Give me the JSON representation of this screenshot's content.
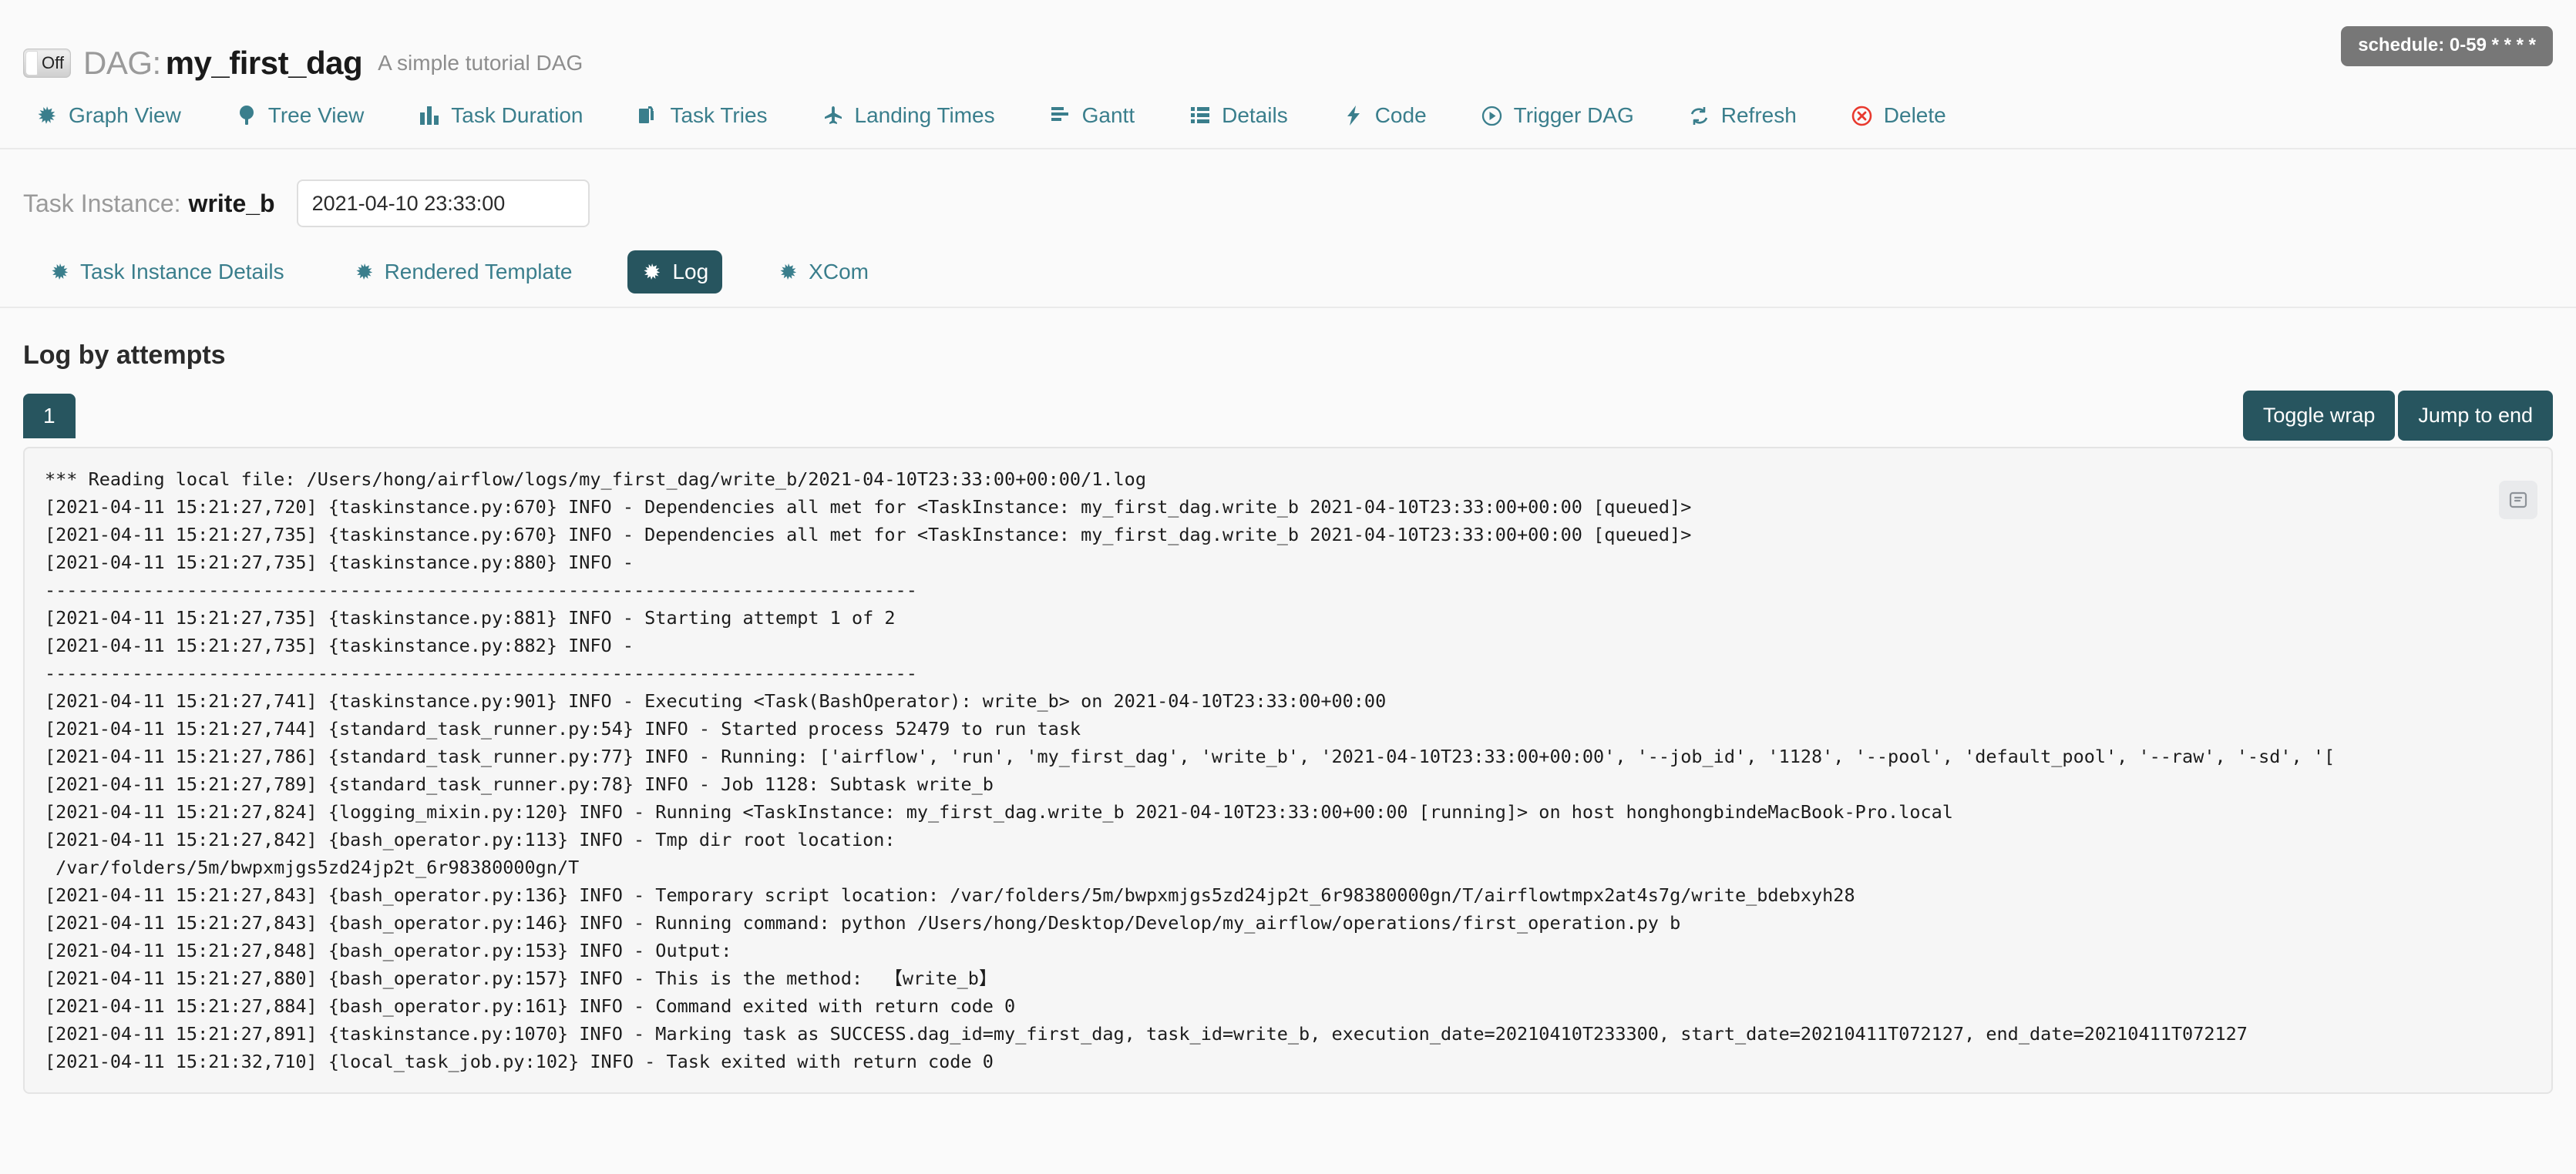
{
  "header": {
    "toggle_label": "Off",
    "dag_word": "DAG:",
    "dag_id": "my_first_dag",
    "description": "A simple tutorial DAG",
    "schedule_badge": "schedule: 0-59 * * * *"
  },
  "main_nav": [
    {
      "label": "Graph View",
      "icon": "asterisk-icon"
    },
    {
      "label": "Tree View",
      "icon": "tree-icon"
    },
    {
      "label": "Task Duration",
      "icon": "bar-chart-icon"
    },
    {
      "label": "Task Tries",
      "icon": "copy-files-icon"
    },
    {
      "label": "Landing Times",
      "icon": "plane-icon"
    },
    {
      "label": "Gantt",
      "icon": "align-left-icon"
    },
    {
      "label": "Details",
      "icon": "list-icon"
    },
    {
      "label": "Code",
      "icon": "bolt-icon"
    },
    {
      "label": "Trigger DAG",
      "icon": "play-circle-icon"
    },
    {
      "label": "Refresh",
      "icon": "refresh-icon"
    },
    {
      "label": "Delete",
      "icon": "delete-circle-icon"
    }
  ],
  "task_instance": {
    "label": "Task Instance:",
    "task_id": "write_b",
    "execution_date": "2021-04-10 23:33:00",
    "date_placeholder": "2021-04-10 23:33:00"
  },
  "sub_tabs": [
    {
      "label": "Task Instance Details",
      "icon": "asterisk-icon",
      "active": false
    },
    {
      "label": "Rendered Template",
      "icon": "asterisk-icon",
      "active": false
    },
    {
      "label": "Log",
      "icon": "asterisk-icon",
      "active": true
    },
    {
      "label": "XCom",
      "icon": "asterisk-icon",
      "active": false
    }
  ],
  "log_section": {
    "heading": "Log by attempts",
    "attempt_tabs": [
      "1"
    ],
    "toggle_wrap_label": "Toggle wrap",
    "jump_to_end_label": "Jump to end"
  },
  "colors": {
    "accent_teal": "#3a7e8c",
    "active_teal": "#27555f",
    "delete_red": "#e8392e",
    "badge_grey": "#777777",
    "log_bg": "#f6f6f6"
  },
  "log_lines": [
    "*** Reading local file: /Users/hong/airflow/logs/my_first_dag/write_b/2021-04-10T23:33:00+00:00/1.log",
    "[2021-04-11 15:21:27,720] {taskinstance.py:670} INFO - Dependencies all met for <TaskInstance: my_first_dag.write_b 2021-04-10T23:33:00+00:00 [queued]>",
    "[2021-04-11 15:21:27,735] {taskinstance.py:670} INFO - Dependencies all met for <TaskInstance: my_first_dag.write_b 2021-04-10T23:33:00+00:00 [queued]>",
    "[2021-04-11 15:21:27,735] {taskinstance.py:880} INFO - ",
    "--------------------------------------------------------------------------------",
    "[2021-04-11 15:21:27,735] {taskinstance.py:881} INFO - Starting attempt 1 of 2",
    "[2021-04-11 15:21:27,735] {taskinstance.py:882} INFO - ",
    "--------------------------------------------------------------------------------",
    "[2021-04-11 15:21:27,741] {taskinstance.py:901} INFO - Executing <Task(BashOperator): write_b> on 2021-04-10T23:33:00+00:00",
    "[2021-04-11 15:21:27,744] {standard_task_runner.py:54} INFO - Started process 52479 to run task",
    "[2021-04-11 15:21:27,786] {standard_task_runner.py:77} INFO - Running: ['airflow', 'run', 'my_first_dag', 'write_b', '2021-04-10T23:33:00+00:00', '--job_id', '1128', '--pool', 'default_pool', '--raw', '-sd', '[",
    "[2021-04-11 15:21:27,789] {standard_task_runner.py:78} INFO - Job 1128: Subtask write_b",
    "[2021-04-11 15:21:27,824] {logging_mixin.py:120} INFO - Running <TaskInstance: my_first_dag.write_b 2021-04-10T23:33:00+00:00 [running]> on host honghongbindeMacBook-Pro.local",
    "[2021-04-11 15:21:27,842] {bash_operator.py:113} INFO - Tmp dir root location: ",
    " /var/folders/5m/bwpxmjgs5zd24jp2t_6r98380000gn/T",
    "[2021-04-11 15:21:27,843] {bash_operator.py:136} INFO - Temporary script location: /var/folders/5m/bwpxmjgs5zd24jp2t_6r98380000gn/T/airflowtmpx2at4s7g/write_bdebxyh28",
    "[2021-04-11 15:21:27,843] {bash_operator.py:146} INFO - Running command: python /Users/hong/Desktop/Develop/my_airflow/operations/first_operation.py b",
    "[2021-04-11 15:21:27,848] {bash_operator.py:153} INFO - Output:",
    "[2021-04-11 15:21:27,880] {bash_operator.py:157} INFO - This is the method:  【write_b】",
    "[2021-04-11 15:21:27,884] {bash_operator.py:161} INFO - Command exited with return code 0",
    "[2021-04-11 15:21:27,891] {taskinstance.py:1070} INFO - Marking task as SUCCESS.dag_id=my_first_dag, task_id=write_b, execution_date=20210410T233300, start_date=20210411T072127, end_date=20210411T072127",
    "[2021-04-11 15:21:32,710] {local_task_job.py:102} INFO - Task exited with return code 0"
  ]
}
